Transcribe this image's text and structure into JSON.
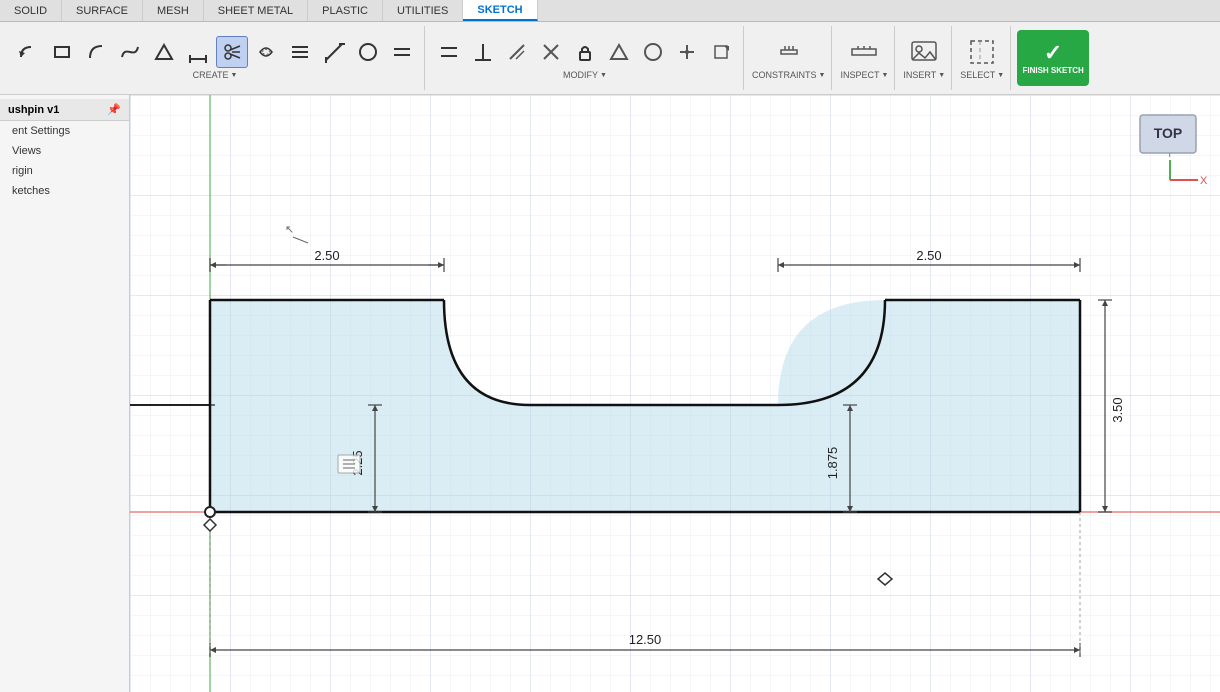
{
  "tabs": [
    {
      "label": "SOLID",
      "active": false
    },
    {
      "label": "SURFACE",
      "active": false
    },
    {
      "label": "MESH",
      "active": false
    },
    {
      "label": "SHEET METAL",
      "active": false
    },
    {
      "label": "PLASTIC",
      "active": false
    },
    {
      "label": "UTILITIES",
      "active": false
    },
    {
      "label": "SKETCH",
      "active": true
    }
  ],
  "toolbar_groups": [
    {
      "label": "CREATE",
      "has_arrow": true,
      "tools": [
        "undo-arc",
        "rectangle",
        "circle-line",
        "bezier",
        "triangle",
        "dimension",
        "scissor-cut",
        "loop-trim",
        "hatch",
        "line-tool",
        "circle",
        "ellipse",
        "constraint-p",
        "constraint-perp",
        "lock",
        "triangle2",
        "circle2",
        "point",
        "box2",
        "expand"
      ]
    },
    {
      "label": "MODIFY",
      "has_arrow": true,
      "tools": []
    },
    {
      "label": "CONSTRAINTS",
      "has_arrow": true,
      "tools": []
    },
    {
      "label": "INSPECT",
      "has_arrow": true,
      "tools": []
    },
    {
      "label": "INSERT",
      "has_arrow": true,
      "tools": []
    },
    {
      "label": "SELECT",
      "has_arrow": true,
      "tools": []
    }
  ],
  "finish_sketch": {
    "label": "FINISH SKETCH",
    "has_arrow": true
  },
  "sidebar": {
    "title": "ushpin v1",
    "items": [
      {
        "label": "ent Settings"
      },
      {
        "label": "Views"
      },
      {
        "label": "rigin"
      },
      {
        "label": "ketches"
      }
    ]
  },
  "sketch": {
    "dim_top_left": "2.50",
    "dim_top_right": "2.50",
    "dim_left_vert": "2.25",
    "dim_right_vert": "1.875",
    "dim_far_right_vert": "3.50",
    "dim_bottom_horiz": "12.50",
    "view_label": "TOP"
  },
  "colors": {
    "sketch_fill": "rgba(173,216,230,0.45)",
    "sketch_stroke": "#111",
    "grid_line": "#d8dde8",
    "axis_x": "#e05050",
    "axis_y": "#50b050",
    "dim_line": "#444",
    "accent_blue": "#0073cf",
    "finish_green": "#28a745"
  }
}
